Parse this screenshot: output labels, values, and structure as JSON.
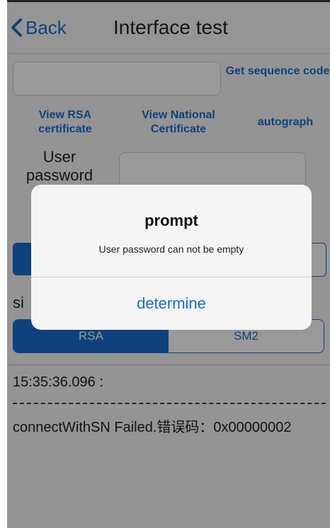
{
  "nav": {
    "back_label": "Back",
    "title": "Interface test"
  },
  "form": {
    "get_sequence_code": "Get sequence code",
    "view_rsa_certificate": "View RSA certificate",
    "view_national_certificate": "View National Certificate",
    "autograph": "autograph",
    "user_password_label": "User password",
    "sign_label": "si",
    "algorithm_tabs": [
      "RSA",
      "SM2"
    ]
  },
  "log": {
    "time": "15:35:36.096 :",
    "message": "connectWithSN Failed.错误码：0x00000002"
  },
  "dialog": {
    "title": "prompt",
    "message": "User password can not be empty",
    "button": "determine"
  },
  "colors": {
    "accent": "#1a6fd1",
    "overlay": "rgba(0,0,0,0.4)"
  },
  "icons": {
    "back": "chevron-left-icon"
  }
}
